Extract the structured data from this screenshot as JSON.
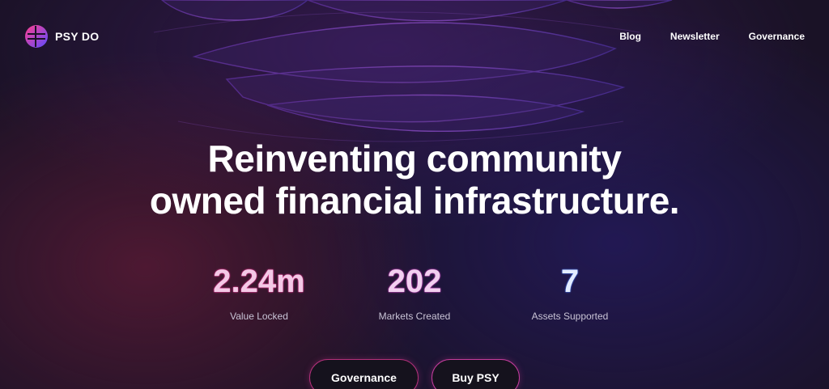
{
  "brand": {
    "name": "PSY DO",
    "logo_icon": "psy-logo-icon"
  },
  "nav": {
    "items": [
      {
        "label": "Blog"
      },
      {
        "label": "Newsletter"
      },
      {
        "label": "Governance"
      }
    ]
  },
  "hero": {
    "title_line1": "Reinventing community",
    "title_line2": "owned financial infrastructure."
  },
  "stats": [
    {
      "value": "2.24m",
      "label": "Value Locked",
      "color": "#ff3fa0"
    },
    {
      "value": "202",
      "label": "Markets Created",
      "color": "#e04bd0"
    },
    {
      "value": "7",
      "label": "Assets Supported",
      "color": "#4a7dff"
    }
  ],
  "actions": {
    "governance_label": "Governance",
    "buy_label": "Buy PSY"
  },
  "colors": {
    "background": "#1a1226",
    "accent_pink": "#c9378c",
    "accent_blue": "#4a7dff"
  }
}
